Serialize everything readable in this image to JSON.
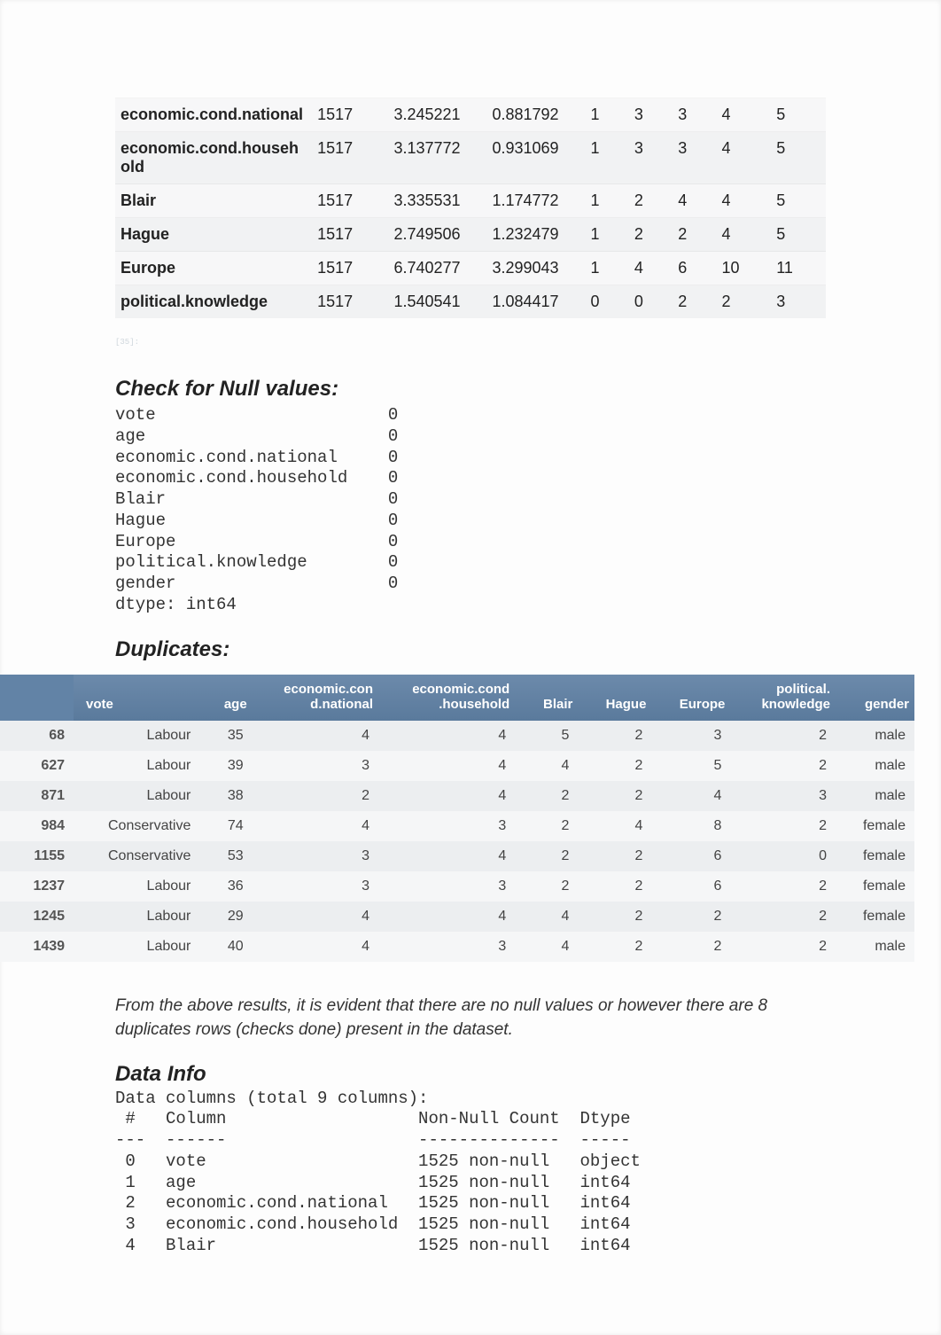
{
  "stats": {
    "col_widths": [
      "180px",
      "70px",
      "90px",
      "90px",
      "40px",
      "40px",
      "40px",
      "50px",
      "50px"
    ],
    "rows": [
      {
        "name": "economic.cond.national",
        "cells": [
          "1517",
          "3.245221",
          "0.881792",
          "1",
          "3",
          "3",
          "4",
          "5"
        ]
      },
      {
        "name": "economic.cond.household",
        "cells": [
          "1517",
          "3.137772",
          "0.931069",
          "1",
          "3",
          "3",
          "4",
          "5"
        ]
      },
      {
        "name": "Blair",
        "cells": [
          "1517",
          "3.335531",
          "1.174772",
          "1",
          "2",
          "4",
          "4",
          "5"
        ]
      },
      {
        "name": "Hague",
        "cells": [
          "1517",
          "2.749506",
          "1.232479",
          "1",
          "2",
          "2",
          "4",
          "5"
        ]
      },
      {
        "name": "Europe",
        "cells": [
          "1517",
          "6.740277",
          "3.299043",
          "1",
          "4",
          "6",
          "10",
          "11"
        ]
      },
      {
        "name": "political.knowledge",
        "cells": [
          "1517",
          "1.540541",
          "1.084417",
          "0",
          "0",
          "2",
          "2",
          "3"
        ]
      }
    ]
  },
  "small_code": "[35]:",
  "sections": {
    "null_title": "Check for Null values:",
    "dup_title": "Duplicates:",
    "info_title": "Data Info"
  },
  "null_block": "vote                       0\nage                        0\neconomic.cond.national     0\neconomic.cond.household    0\nBlair                      0\nHague                      0\nEurope                     0\npolitical.knowledge        0\ngender                     0\ndtype: int64",
  "dup": {
    "col_widths": [
      "70px",
      "120px",
      "50px",
      "120px",
      "130px",
      "60px",
      "70px",
      "75px",
      "100px",
      "75px"
    ],
    "headers": [
      "",
      "vote",
      "age",
      "economic.cond.national",
      "economic.cond.household",
      "Blair",
      "Hague",
      "Europe",
      "political.knowledge",
      "gender"
    ],
    "header_display": [
      "",
      "vote",
      "age",
      "economic.con\nd.national",
      "economic.cond\n.household",
      "Blair",
      "Hague",
      "Europe",
      "political.\nknowledge",
      "gender"
    ],
    "rows": [
      {
        "idx": "68",
        "cells": [
          "Labour",
          "35",
          "4",
          "4",
          "5",
          "2",
          "3",
          "2",
          "male"
        ]
      },
      {
        "idx": "627",
        "cells": [
          "Labour",
          "39",
          "3",
          "4",
          "4",
          "2",
          "5",
          "2",
          "male"
        ]
      },
      {
        "idx": "871",
        "cells": [
          "Labour",
          "38",
          "2",
          "4",
          "2",
          "2",
          "4",
          "3",
          "male"
        ]
      },
      {
        "idx": "984",
        "cells": [
          "Conservative",
          "74",
          "4",
          "3",
          "2",
          "4",
          "8",
          "2",
          "female"
        ]
      },
      {
        "idx": "1155",
        "cells": [
          "Conservative",
          "53",
          "3",
          "4",
          "2",
          "2",
          "6",
          "0",
          "female"
        ]
      },
      {
        "idx": "1237",
        "cells": [
          "Labour",
          "36",
          "3",
          "3",
          "2",
          "2",
          "6",
          "2",
          "female"
        ]
      },
      {
        "idx": "1245",
        "cells": [
          "Labour",
          "29",
          "4",
          "4",
          "4",
          "2",
          "2",
          "2",
          "female"
        ]
      },
      {
        "idx": "1439",
        "cells": [
          "Labour",
          "40",
          "4",
          "3",
          "4",
          "2",
          "2",
          "2",
          "male"
        ]
      }
    ]
  },
  "note": "From the above results, it is evident that there are no null values or however there are 8 duplicates rows (checks done) present in the dataset.",
  "info_block": "Data columns (total 9 columns):\n #   Column                   Non-Null Count  Dtype\n---  ------                   --------------  -----\n 0   vote                     1525 non-null   object\n 1   age                      1525 non-null   int64\n 2   economic.cond.national   1525 non-null   int64\n 3   economic.cond.household  1525 non-null   int64\n 4   Blair                    1525 non-null   int64"
}
